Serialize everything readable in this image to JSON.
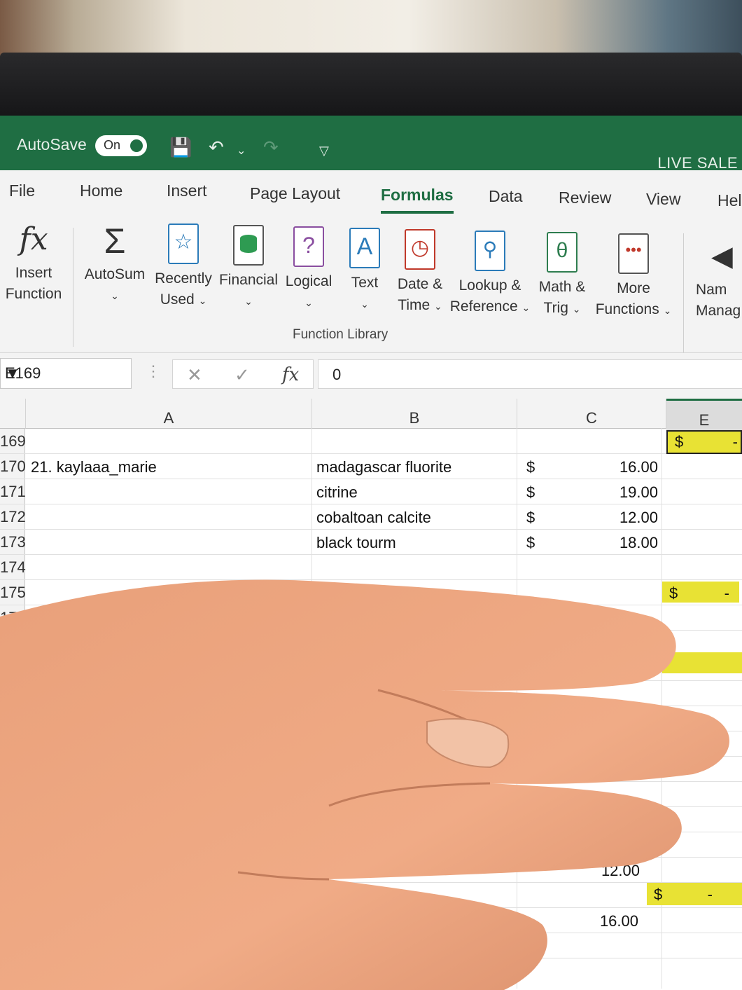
{
  "titlebar": {
    "autosave_label": "AutoSave",
    "autosave_state": "On",
    "file_title": "LIVE SALE"
  },
  "tabs": [
    "File",
    "Home",
    "Insert",
    "Page Layout",
    "Formulas",
    "Data",
    "Review",
    "View",
    "Hel"
  ],
  "active_tab": "Formulas",
  "ribbon": {
    "insert_function": [
      "Insert",
      "Function"
    ],
    "autosum": "AutoSum",
    "recently_used": [
      "Recently",
      "Used"
    ],
    "financial": "Financial",
    "logical": "Logical",
    "text": "Text",
    "date_time": [
      "Date &",
      "Time"
    ],
    "lookup_reference": [
      "Lookup &",
      "Reference"
    ],
    "math_trig": [
      "Math &",
      "Trig"
    ],
    "more_functions": [
      "More",
      "Functions"
    ],
    "name_manager": [
      "Nam",
      "Manag"
    ],
    "group_label": "Function Library"
  },
  "formula_bar": {
    "name_box": "E169",
    "formula_value": "0"
  },
  "columns": [
    "A",
    "B",
    "C",
    "E"
  ],
  "rows": [
    {
      "num": "169",
      "a": "",
      "b": "",
      "c_sign": "",
      "c_val": "",
      "e_sign": "$",
      "e_val": "-"
    },
    {
      "num": "170",
      "a": "21. kaylaaa_marie",
      "b": "madagascar fluorite",
      "c_sign": "$",
      "c_val": "16.00",
      "e_sign": "",
      "e_val": ""
    },
    {
      "num": "171",
      "a": "",
      "b": "citrine",
      "c_sign": "$",
      "c_val": "19.00",
      "e_sign": "",
      "e_val": ""
    },
    {
      "num": "172",
      "a": "",
      "b": "cobaltoan calcite",
      "c_sign": "$",
      "c_val": "12.00",
      "e_sign": "",
      "e_val": ""
    },
    {
      "num": "173",
      "a": "",
      "b": "black tourm",
      "c_sign": "$",
      "c_val": "18.00",
      "e_sign": "",
      "e_val": ""
    },
    {
      "num": "174",
      "a": "",
      "b": "",
      "c_sign": "",
      "c_val": "",
      "e_sign": "",
      "e_val": ""
    },
    {
      "num": "175",
      "a": "",
      "b": "",
      "c_sign": "",
      "c_val": "",
      "e_sign": "$",
      "e_val": "-"
    },
    {
      "num": "176",
      "a": "",
      "b": "",
      "c_sign": "",
      "c_val": "",
      "e_sign": "",
      "e_val": ""
    }
  ],
  "lower_visible": {
    "val1": "12.00",
    "sign": "$",
    "dash": "-",
    "val2": "16.00"
  },
  "colors": {
    "excel_green": "#1f6e43",
    "highlight_yellow": "#e8e234"
  }
}
